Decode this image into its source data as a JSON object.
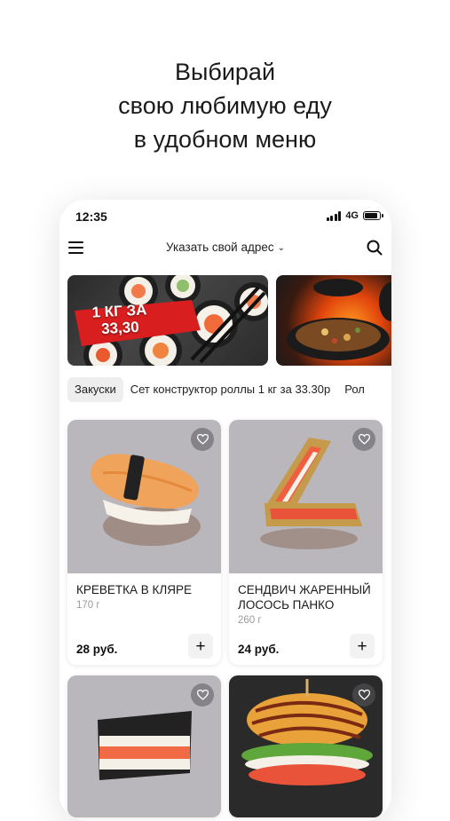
{
  "headline": {
    "line1": "Выбирай",
    "line2": "свою любимую еду",
    "line3": "в удобном меню"
  },
  "status_bar": {
    "time": "12:35",
    "network": "4G"
  },
  "header": {
    "address": "Указать свой адрес"
  },
  "banners": [
    {
      "promo_text_1": "1 КГ ЗА",
      "promo_text_2": "33,30"
    }
  ],
  "categories": [
    "Закуски",
    "Сет конструктор роллы 1 кг за 33.30р",
    "Рол"
  ],
  "products": [
    {
      "name": "КРЕВЕТКА В КЛЯРЕ",
      "weight": "170 г",
      "price": "28 руб.",
      "add": "+"
    },
    {
      "name": "СЕНДВИЧ ЖАРЕННЫЙ ЛОСОСЬ ПАНКО",
      "weight": "260 г",
      "price": "24 руб.",
      "add": "+"
    }
  ],
  "colors": {
    "accent_red": "#d81e1e",
    "text": "#111111",
    "muted": "#9a9a9a",
    "chip_bg": "#eeeeee"
  }
}
